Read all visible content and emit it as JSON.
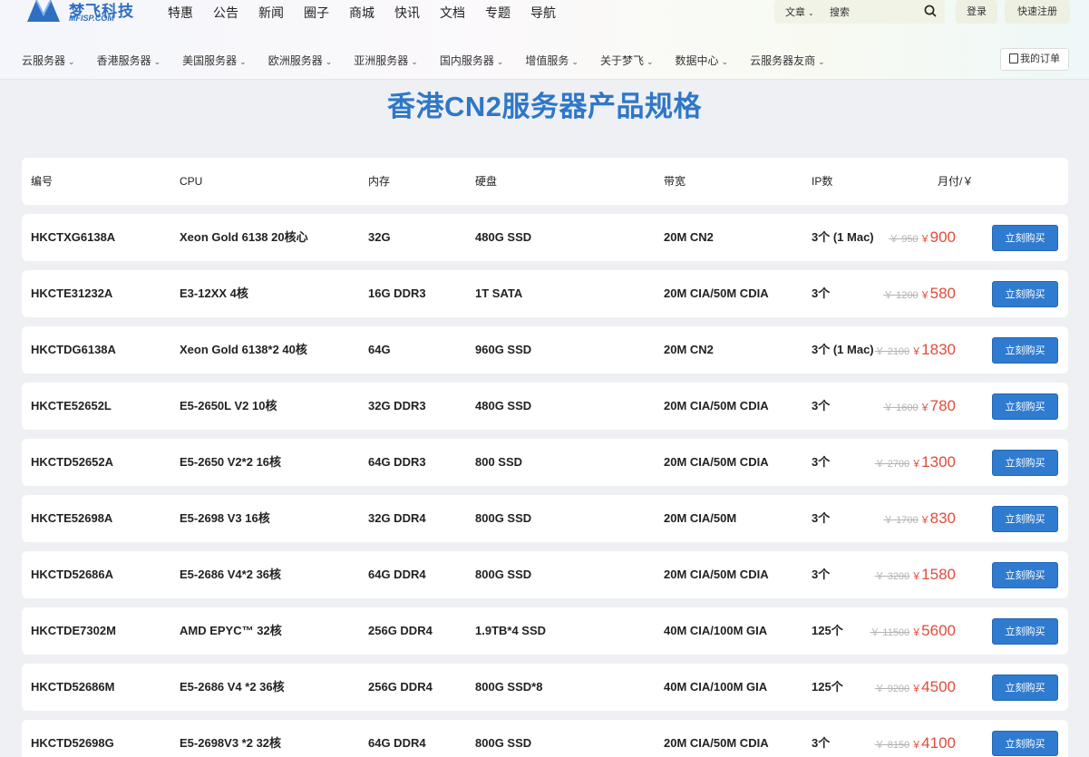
{
  "header": {
    "logo_text": "梦飞科技",
    "logo_sub": "MFISP.COM",
    "top_nav": [
      "特惠",
      "公告",
      "新闻",
      "圈子",
      "商城",
      "快讯",
      "文档",
      "专题",
      "导航"
    ],
    "search": {
      "category": "文章",
      "placeholder": "搜索"
    },
    "login_label": "登录",
    "register_label": "快速注册",
    "sub_nav": [
      "云服务器",
      "香港服务器",
      "美国服务器",
      "欧洲服务器",
      "亚洲服务器",
      "国内服务器",
      "增值服务",
      "关于梦飞",
      "数据中心",
      "云服务器友商"
    ],
    "orders_label": "我的订单"
  },
  "page_title": "香港CN2服务器产品规格",
  "table": {
    "headers": {
      "id": "编号",
      "cpu": "CPU",
      "memory": "内存",
      "disk": "硬盘",
      "bandwidth": "带宽",
      "ip": "IP数",
      "monthly": "月付/￥"
    },
    "currency": "￥",
    "buy_label": "立刻购买",
    "rows": [
      {
        "id": "HKCTXG6138A",
        "cpu": "Xeon Gold 6138 20核心",
        "memory": "32G",
        "disk": "480G SSD",
        "bandwidth": "20M CN2",
        "ip": "3个 (1 Mac)",
        "old_price": "￥ 950",
        "price": "900"
      },
      {
        "id": "HKCTE31232A",
        "cpu": "E3-12XX 4核",
        "memory": "16G DDR3",
        "disk": "1T SATA",
        "bandwidth": "20M CIA/50M CDIA",
        "ip": "3个",
        "old_price": "￥ 1200",
        "price": "580"
      },
      {
        "id": "HKCTDG6138A",
        "cpu": "Xeon Gold 6138*2 40核",
        "memory": "64G",
        "disk": "960G SSD",
        "bandwidth": "20M CN2",
        "ip": "3个 (1 Mac)",
        "old_price": "￥ 2100",
        "price": "1830"
      },
      {
        "id": "HKCTE52652L",
        "cpu": "E5-2650L V2 10核",
        "memory": "32G DDR3",
        "disk": "480G SSD",
        "bandwidth": "20M CIA/50M CDIA",
        "ip": "3个",
        "old_price": "￥ 1600",
        "price": "780"
      },
      {
        "id": "HKCTD52652A",
        "cpu": "E5-2650 V2*2 16核",
        "memory": "64G DDR3",
        "disk": "800 SSD",
        "bandwidth": "20M CIA/50M CDIA",
        "ip": "3个",
        "old_price": "￥ 2700",
        "price": "1300"
      },
      {
        "id": "HKCTE52698A",
        "cpu": "E5-2698 V3 16核",
        "memory": "32G DDR4",
        "disk": "800G SSD",
        "bandwidth": "20M CIA/50M",
        "ip": "3个",
        "old_price": "￥ 1700",
        "price": "830"
      },
      {
        "id": "HKCTD52686A",
        "cpu": "E5-2686 V4*2 36核",
        "memory": "64G DDR4",
        "disk": "800G SSD",
        "bandwidth": "20M CIA/50M CDIA",
        "ip": "3个",
        "old_price": "￥ 3200",
        "price": "1580"
      },
      {
        "id": "HKCTDE7302M",
        "cpu": "AMD EPYC™ 32核",
        "memory": "256G DDR4",
        "disk": "1.9TB*4 SSD",
        "bandwidth": "40M CIA/100M GIA",
        "ip": "125个",
        "old_price": "￥ 11500",
        "price": "5600"
      },
      {
        "id": "HKCTD52686M",
        "cpu": "E5-2686 V4 *2 36核",
        "memory": "256G DDR4",
        "disk": "800G SSD*8",
        "bandwidth": "40M CIA/100M GIA",
        "ip": "125个",
        "old_price": "￥ 9200",
        "price": "4500"
      },
      {
        "id": "HKCTD52698G",
        "cpu": "E5-2698V3 *2 32核",
        "memory": "64G DDR4",
        "disk": "800G SSD",
        "bandwidth": "20M CIA/50M CDIA",
        "ip": "3个",
        "old_price": "￥ 8150",
        "price": "4100"
      }
    ]
  },
  "colors": {
    "accent": "#2f77c7",
    "price": "#e24a3b",
    "button": "#2f7bcf"
  }
}
